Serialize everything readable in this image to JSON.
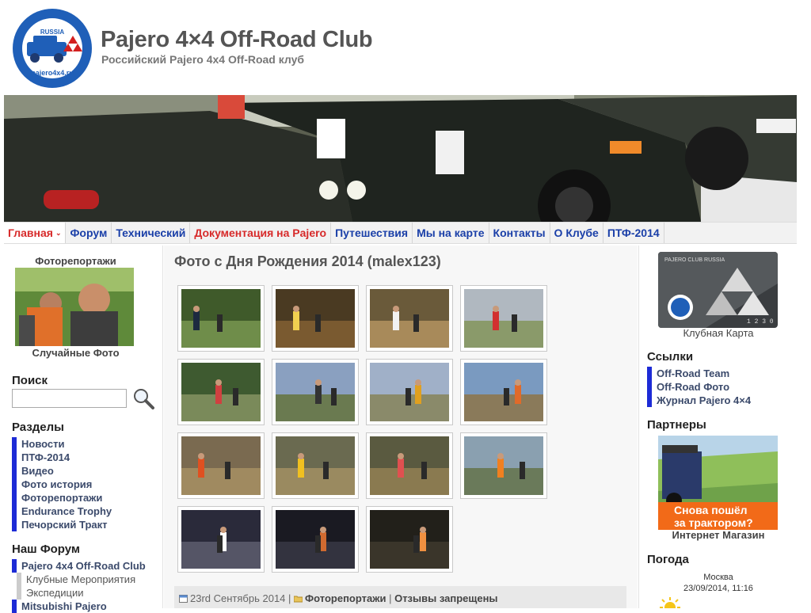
{
  "header": {
    "title": "Pajero 4×4 Off-Road Club",
    "subtitle": "Российский Pajero 4x4 Off-Road клуб",
    "logo_text_top": "Pajero 4x4 Off-Road Club",
    "logo_text_mid": "RUSSIA",
    "logo_text_bottom": "pajero4x4.ru"
  },
  "nav": {
    "items": [
      {
        "label": "Главная",
        "has_arrow": true
      },
      {
        "label": "Форум"
      },
      {
        "label": "Технический"
      },
      {
        "label": "Документация на Pajero"
      },
      {
        "label": "Путешествия"
      },
      {
        "label": "Мы на карте"
      },
      {
        "label": "Контакты"
      },
      {
        "label": "О Клубе"
      },
      {
        "label": "ПТФ-2014"
      }
    ]
  },
  "left": {
    "photoreports_title": "Фоторепортажи",
    "random_photos_caption": "Случайные Фото",
    "search_title": "Поиск",
    "search_value": "",
    "sections_title": "Разделы",
    "sections": [
      "Новости",
      "ПТФ-2014",
      "Видео",
      "Фото история",
      "Фоторепортажи",
      "Endurance Trophy",
      "Печорский Тракт"
    ],
    "forum_title": "Наш Форум",
    "forum_items": [
      {
        "label": "Pajero 4x4 Off-Road Club",
        "sub": false
      },
      {
        "label": "Клубные Мероприятия",
        "sub": true
      },
      {
        "label": "Экспедиции",
        "sub": true
      },
      {
        "label": "Mitsubishi Pajero",
        "sub": false
      }
    ]
  },
  "post": {
    "title": "Фото с Дня Рождения 2014 (malex123)",
    "date": "23rd Сентябрь 2014",
    "category": "Фоторепортажи",
    "comments": "Отзывы запрещены",
    "separator": "|"
  },
  "right": {
    "card_caption": "Клубная Карта",
    "card_text": "PAJERO CLUB RUSSIA",
    "card_number": "1 2 3 0",
    "links_title": "Ссылки",
    "links": [
      "Off-Road Team",
      "Off-Road Фото",
      "Журнал Pajero 4×4"
    ],
    "partners_title": "Партнеры",
    "partner_banner_line1": "Снова пошёл",
    "partner_banner_line2": "за трактором?",
    "partner_caption": "Интернет Магазин",
    "weather_title": "Погода",
    "weather_city": "Москва",
    "weather_time": "23/09/2014, 11:16"
  },
  "colors": {
    "nav_link": "#1a3fa8",
    "nav_active": "#d72a2a",
    "list_marker": "#1d2bd6",
    "partner_orange": "#f26a18"
  }
}
